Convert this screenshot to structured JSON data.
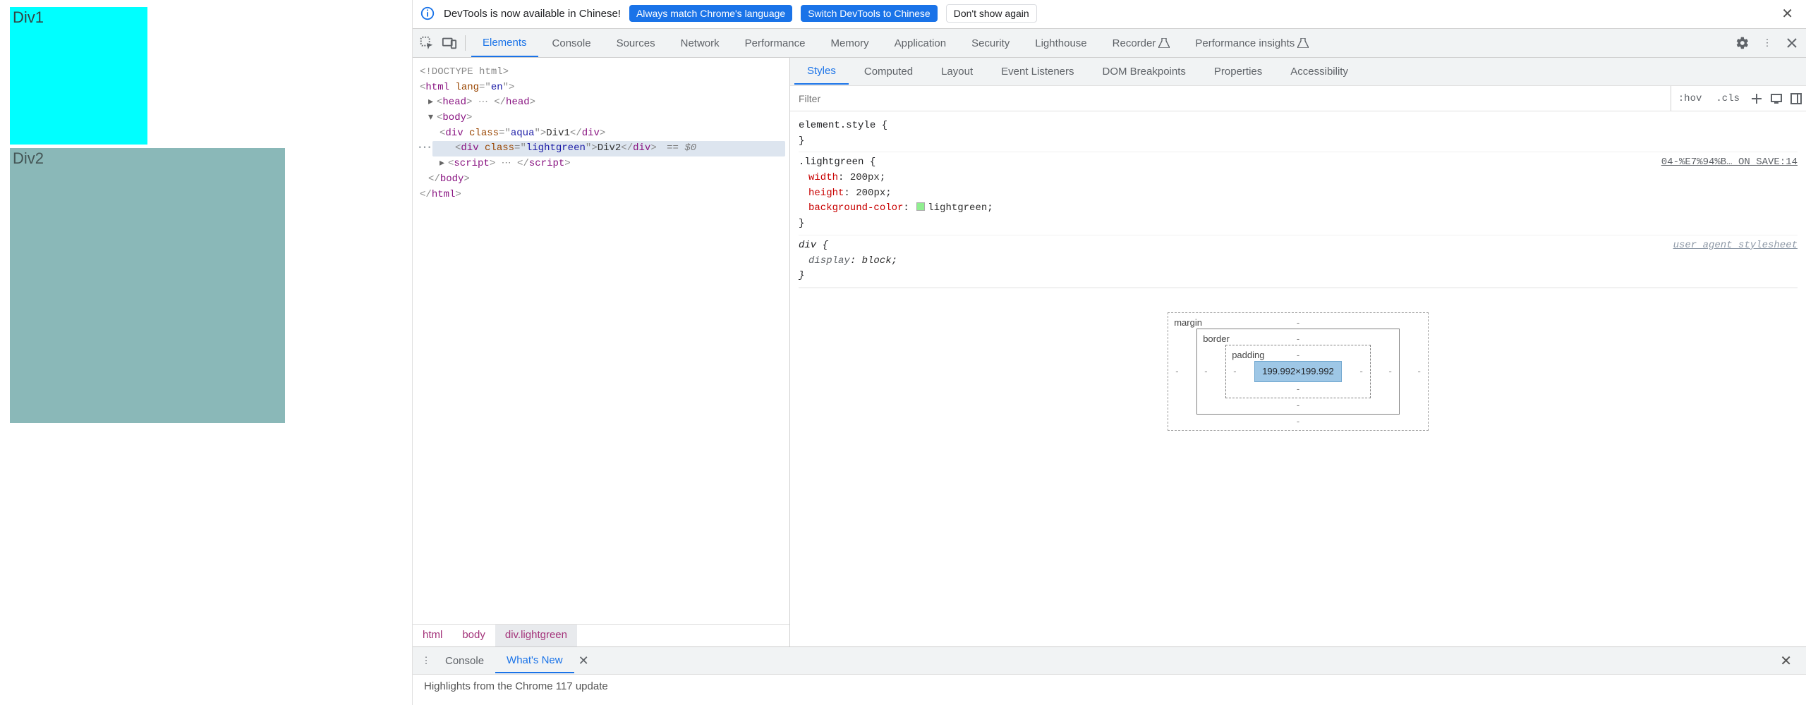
{
  "page": {
    "div1_text": "Div1",
    "div2_text": "Div2"
  },
  "infobar": {
    "message": "DevTools is now available in Chinese!",
    "btn_match": "Always match Chrome's language",
    "btn_switch": "Switch DevTools to Chinese",
    "btn_dont": "Don't show again"
  },
  "main_tabs": {
    "items": [
      "Elements",
      "Console",
      "Sources",
      "Network",
      "Performance",
      "Memory",
      "Application",
      "Security",
      "Lighthouse",
      "Recorder",
      "Performance insights"
    ],
    "active": "Elements"
  },
  "dom": {
    "doctype": "<!DOCTYPE html>",
    "html_open": {
      "tag": "html",
      "attrs": [
        {
          "n": "lang",
          "v": "en"
        }
      ]
    },
    "head": {
      "tag": "head"
    },
    "body": {
      "tag": "body"
    },
    "div1": {
      "tag": "div",
      "attrs": [
        {
          "n": "class",
          "v": "aqua"
        }
      ],
      "text": "Div1"
    },
    "div2": {
      "tag": "div",
      "attrs": [
        {
          "n": "class",
          "v": "lightgreen"
        }
      ],
      "text": "Div2",
      "selected_marker": "== $0"
    },
    "script": {
      "tag": "script"
    },
    "body_close": "</body>",
    "html_close": "</html>"
  },
  "breadcrumbs": [
    "html",
    "body",
    "div.lightgreen"
  ],
  "styles_tabs": {
    "items": [
      "Styles",
      "Computed",
      "Layout",
      "Event Listeners",
      "DOM Breakpoints",
      "Properties",
      "Accessibility"
    ],
    "active": "Styles"
  },
  "filter": {
    "placeholder": "Filter",
    "hov_label": ":hov",
    "cls_label": ".cls"
  },
  "rules": {
    "element_style_label": "element.style",
    "lightgreen": {
      "selector": ".lightgreen",
      "source": "04-%E7%94%B…_ON_SAVE:14",
      "props": [
        {
          "name": "width",
          "value": "200px"
        },
        {
          "name": "height",
          "value": "200px"
        },
        {
          "name": "background-color",
          "value": "lightgreen",
          "swatch": true
        }
      ]
    },
    "div_ua": {
      "selector": "div",
      "ua_label": "user agent stylesheet",
      "props": [
        {
          "name": "display",
          "value": "block"
        }
      ]
    }
  },
  "box_model": {
    "margin_label": "margin",
    "border_label": "border",
    "padding_label": "padding",
    "content": "199.992×199.992",
    "dash": "-"
  },
  "drawer": {
    "tabs": [
      "Console",
      "What's New"
    ],
    "active": "What's New",
    "body": "Highlights from the Chrome 117 update"
  }
}
